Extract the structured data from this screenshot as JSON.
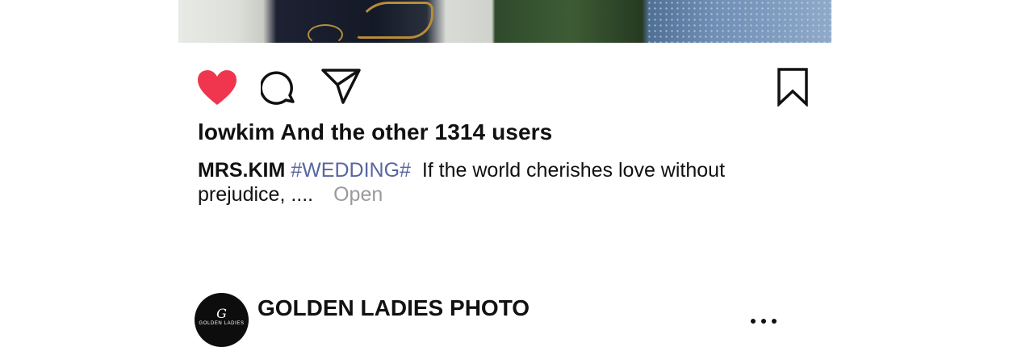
{
  "post": {
    "likes_text": "lowkim And the other 1314 users",
    "caption": {
      "author": "MRS.KIM",
      "hashtag": "#WEDDING#",
      "text": "If the world cherishes love without prejudice, ....",
      "open_label": "Open"
    },
    "liked": true,
    "colors": {
      "heart": "#f0364f",
      "hashtag": "#5a64a0",
      "open": "#9a9a9a"
    },
    "icons": [
      "heart-icon",
      "comment-icon",
      "share-icon",
      "bookmark-icon"
    ]
  },
  "next_post": {
    "account_name": "GOLDEN LADIES PHOTO",
    "avatar": {
      "monogram": "G",
      "brand_text": "GOLDEN LADIES"
    },
    "more_icon": "more-options-icon"
  }
}
